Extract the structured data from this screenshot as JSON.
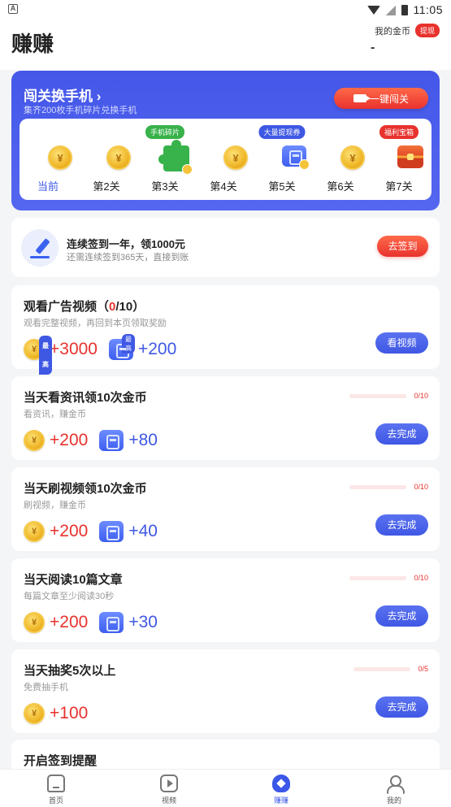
{
  "status_bar": {
    "time": "11:05"
  },
  "header": {
    "title": "赚赚",
    "my_coins_label": "我的金币",
    "withdraw_badge": "提现",
    "coins_value": "-"
  },
  "promo": {
    "title": "闯关换手机 ›",
    "subtitle": "集齐200枚手机碎片兑换手机",
    "button_label": "一键闯关",
    "levels": [
      {
        "label": "当前",
        "icon": "gold-coin-icon",
        "tag": ""
      },
      {
        "label": "第2关",
        "icon": "gold-coin-icon",
        "tag": ""
      },
      {
        "label": "第3关",
        "icon": "phone-fragment-puzzle-icon",
        "tag": "手机碎片",
        "tag_color": "#38b24a"
      },
      {
        "label": "第4关",
        "icon": "gold-coin-icon",
        "tag": ""
      },
      {
        "label": "第5关",
        "icon": "withdraw-ticket-icon",
        "tag": "大量提现券",
        "tag_color": "#3f58e4"
      },
      {
        "label": "第6关",
        "icon": "gold-coin-icon",
        "tag": ""
      },
      {
        "label": "第7关",
        "icon": "treasure-chest-icon",
        "tag": "福利宝箱",
        "tag_color": "#e8322d"
      }
    ]
  },
  "signin": {
    "title": "连续签到一年，领1000元",
    "subtitle": "还需连续签到365天，直接到账",
    "button_label": "去签到"
  },
  "tasks": [
    {
      "title_main": "观看广告视频（",
      "title_count": "0",
      "title_rest": "/10）",
      "subtitle": "观看完整视频，再回到本页领取奖励",
      "coin_reward": "+3000",
      "ticket_reward": "+200",
      "max_tag": "最高",
      "button_label": "看视频"
    },
    {
      "title": "当天看资讯领10次金币",
      "subtitle": "看资讯，赚金币",
      "coin_reward": "+200",
      "ticket_reward": "+80",
      "progress_text": "0/10",
      "progress": 0,
      "button_label": "去完成"
    },
    {
      "title": "当天刷视频领10次金币",
      "subtitle": "刷视频，赚金币",
      "coin_reward": "+200",
      "ticket_reward": "+40",
      "progress_text": "0/10",
      "progress": 0,
      "button_label": "去完成"
    },
    {
      "title": "当天阅读10篇文章",
      "subtitle": "每篇文章至少阅读30秒",
      "coin_reward": "+200",
      "ticket_reward": "+30",
      "progress_text": "0/10",
      "progress": 0,
      "button_label": "去完成"
    },
    {
      "title": "当天抽奖5次以上",
      "subtitle": "免费抽手机",
      "coin_reward": "+100",
      "progress_text": "0/5",
      "progress": 0,
      "button_label": "去完成"
    },
    {
      "title": "开启签到提醒"
    }
  ],
  "bottom_nav": [
    {
      "label": "首页",
      "icon": "home-icon",
      "active": false
    },
    {
      "label": "视频",
      "icon": "video-play-icon",
      "active": false
    },
    {
      "label": "赚赚",
      "icon": "earn-icon",
      "active": true
    },
    {
      "label": "我的",
      "icon": "profile-icon",
      "active": false
    }
  ],
  "colors": {
    "accent_blue": "#3f58e4",
    "accent_red": "#e8322d",
    "promo_bg": "#4457e8",
    "coin_gold": "#f0b82a",
    "puzzle_green": "#38b24a"
  }
}
